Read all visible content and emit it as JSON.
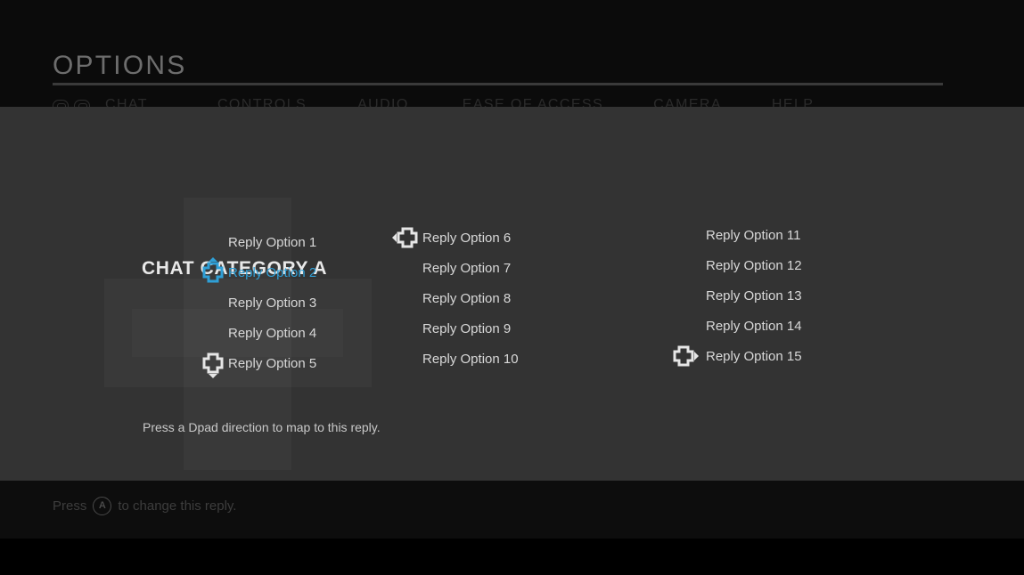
{
  "header": {
    "title": "OPTIONS",
    "tabs": [
      {
        "label": "CHAT"
      },
      {
        "label": "CONTROLS"
      },
      {
        "label": "AUDIO"
      },
      {
        "label": "EASE OF ACCESS"
      },
      {
        "label": "CAMERA"
      },
      {
        "label": "HELP"
      }
    ],
    "bumper_left_icon": "left-bumper-icon",
    "bumper_right_icon": "right-bumper-icon"
  },
  "panel": {
    "category_title": "CHAT CATEGORY A",
    "hint": "Press a Dpad direction to map to this reply.",
    "columns": [
      {
        "options": [
          {
            "label": "Reply Option 1",
            "dpad": null,
            "selected": false
          },
          {
            "label": "Reply Option 2",
            "dpad": "up",
            "selected": true
          },
          {
            "label": "Reply Option 3",
            "dpad": null,
            "selected": false
          },
          {
            "label": "Reply Option 4",
            "dpad": null,
            "selected": false
          },
          {
            "label": "Reply Option 5",
            "dpad": "down",
            "selected": false
          }
        ]
      },
      {
        "options": [
          {
            "label": "Reply Option 6",
            "dpad": "left",
            "selected": false
          },
          {
            "label": "Reply Option 7",
            "dpad": null,
            "selected": false
          },
          {
            "label": "Reply Option 8",
            "dpad": null,
            "selected": false
          },
          {
            "label": "Reply Option 9",
            "dpad": null,
            "selected": false
          },
          {
            "label": "Reply Option 10",
            "dpad": null,
            "selected": false
          }
        ]
      },
      {
        "options": [
          {
            "label": "Reply Option 11",
            "dpad": null,
            "selected": false
          },
          {
            "label": "Reply Option 12",
            "dpad": null,
            "selected": false
          },
          {
            "label": "Reply Option 13",
            "dpad": null,
            "selected": false
          },
          {
            "label": "Reply Option 14",
            "dpad": null,
            "selected": false
          },
          {
            "label": "Reply Option 15",
            "dpad": "right",
            "selected": false
          }
        ]
      }
    ]
  },
  "footer": {
    "prefix": "Press",
    "button_glyph": "A",
    "button_icon": "a-button-icon",
    "suffix": "to change this reply."
  },
  "colors": {
    "accent": "#2f9fd6",
    "panel_bg": "#333333",
    "page_bg": "#0b0b0b",
    "text_primary": "#d8d8d8",
    "title": "#6d6d6d"
  }
}
